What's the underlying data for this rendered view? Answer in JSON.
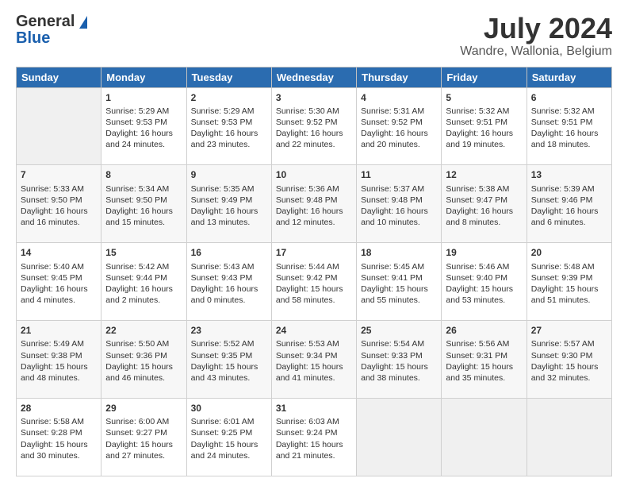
{
  "header": {
    "logo_general": "General",
    "logo_blue": "Blue",
    "title": "July 2024",
    "subtitle": "Wandre, Wallonia, Belgium"
  },
  "days": [
    "Sunday",
    "Monday",
    "Tuesday",
    "Wednesday",
    "Thursday",
    "Friday",
    "Saturday"
  ],
  "weeks": [
    [
      {
        "day": "",
        "content": ""
      },
      {
        "day": "1",
        "content": "Sunrise: 5:29 AM\nSunset: 9:53 PM\nDaylight: 16 hours\nand 24 minutes."
      },
      {
        "day": "2",
        "content": "Sunrise: 5:29 AM\nSunset: 9:53 PM\nDaylight: 16 hours\nand 23 minutes."
      },
      {
        "day": "3",
        "content": "Sunrise: 5:30 AM\nSunset: 9:52 PM\nDaylight: 16 hours\nand 22 minutes."
      },
      {
        "day": "4",
        "content": "Sunrise: 5:31 AM\nSunset: 9:52 PM\nDaylight: 16 hours\nand 20 minutes."
      },
      {
        "day": "5",
        "content": "Sunrise: 5:32 AM\nSunset: 9:51 PM\nDaylight: 16 hours\nand 19 minutes."
      },
      {
        "day": "6",
        "content": "Sunrise: 5:32 AM\nSunset: 9:51 PM\nDaylight: 16 hours\nand 18 minutes."
      }
    ],
    [
      {
        "day": "7",
        "content": "Sunrise: 5:33 AM\nSunset: 9:50 PM\nDaylight: 16 hours\nand 16 minutes."
      },
      {
        "day": "8",
        "content": "Sunrise: 5:34 AM\nSunset: 9:50 PM\nDaylight: 16 hours\nand 15 minutes."
      },
      {
        "day": "9",
        "content": "Sunrise: 5:35 AM\nSunset: 9:49 PM\nDaylight: 16 hours\nand 13 minutes."
      },
      {
        "day": "10",
        "content": "Sunrise: 5:36 AM\nSunset: 9:48 PM\nDaylight: 16 hours\nand 12 minutes."
      },
      {
        "day": "11",
        "content": "Sunrise: 5:37 AM\nSunset: 9:48 PM\nDaylight: 16 hours\nand 10 minutes."
      },
      {
        "day": "12",
        "content": "Sunrise: 5:38 AM\nSunset: 9:47 PM\nDaylight: 16 hours\nand 8 minutes."
      },
      {
        "day": "13",
        "content": "Sunrise: 5:39 AM\nSunset: 9:46 PM\nDaylight: 16 hours\nand 6 minutes."
      }
    ],
    [
      {
        "day": "14",
        "content": "Sunrise: 5:40 AM\nSunset: 9:45 PM\nDaylight: 16 hours\nand 4 minutes."
      },
      {
        "day": "15",
        "content": "Sunrise: 5:42 AM\nSunset: 9:44 PM\nDaylight: 16 hours\nand 2 minutes."
      },
      {
        "day": "16",
        "content": "Sunrise: 5:43 AM\nSunset: 9:43 PM\nDaylight: 16 hours\nand 0 minutes."
      },
      {
        "day": "17",
        "content": "Sunrise: 5:44 AM\nSunset: 9:42 PM\nDaylight: 15 hours\nand 58 minutes."
      },
      {
        "day": "18",
        "content": "Sunrise: 5:45 AM\nSunset: 9:41 PM\nDaylight: 15 hours\nand 55 minutes."
      },
      {
        "day": "19",
        "content": "Sunrise: 5:46 AM\nSunset: 9:40 PM\nDaylight: 15 hours\nand 53 minutes."
      },
      {
        "day": "20",
        "content": "Sunrise: 5:48 AM\nSunset: 9:39 PM\nDaylight: 15 hours\nand 51 minutes."
      }
    ],
    [
      {
        "day": "21",
        "content": "Sunrise: 5:49 AM\nSunset: 9:38 PM\nDaylight: 15 hours\nand 48 minutes."
      },
      {
        "day": "22",
        "content": "Sunrise: 5:50 AM\nSunset: 9:36 PM\nDaylight: 15 hours\nand 46 minutes."
      },
      {
        "day": "23",
        "content": "Sunrise: 5:52 AM\nSunset: 9:35 PM\nDaylight: 15 hours\nand 43 minutes."
      },
      {
        "day": "24",
        "content": "Sunrise: 5:53 AM\nSunset: 9:34 PM\nDaylight: 15 hours\nand 41 minutes."
      },
      {
        "day": "25",
        "content": "Sunrise: 5:54 AM\nSunset: 9:33 PM\nDaylight: 15 hours\nand 38 minutes."
      },
      {
        "day": "26",
        "content": "Sunrise: 5:56 AM\nSunset: 9:31 PM\nDaylight: 15 hours\nand 35 minutes."
      },
      {
        "day": "27",
        "content": "Sunrise: 5:57 AM\nSunset: 9:30 PM\nDaylight: 15 hours\nand 32 minutes."
      }
    ],
    [
      {
        "day": "28",
        "content": "Sunrise: 5:58 AM\nSunset: 9:28 PM\nDaylight: 15 hours\nand 30 minutes."
      },
      {
        "day": "29",
        "content": "Sunrise: 6:00 AM\nSunset: 9:27 PM\nDaylight: 15 hours\nand 27 minutes."
      },
      {
        "day": "30",
        "content": "Sunrise: 6:01 AM\nSunset: 9:25 PM\nDaylight: 15 hours\nand 24 minutes."
      },
      {
        "day": "31",
        "content": "Sunrise: 6:03 AM\nSunset: 9:24 PM\nDaylight: 15 hours\nand 21 minutes."
      },
      {
        "day": "",
        "content": ""
      },
      {
        "day": "",
        "content": ""
      },
      {
        "day": "",
        "content": ""
      }
    ]
  ]
}
